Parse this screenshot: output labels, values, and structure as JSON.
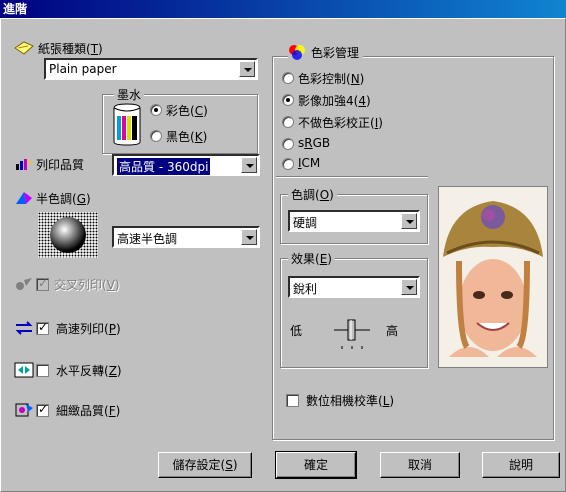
{
  "window": {
    "title": "進階"
  },
  "left": {
    "paper_type": {
      "label": "紙張種類(",
      "key": "T",
      "label_end": ")",
      "value": "Plain paper"
    },
    "ink": {
      "group_label": "墨水",
      "options": [
        {
          "label": "彩色(",
          "key": "C",
          "end": ")",
          "selected": true
        },
        {
          "label": "黑色(",
          "key": "K",
          "end": ")",
          "selected": false
        }
      ]
    },
    "print_quality": {
      "label": "列印品質",
      "value": "高品質 - 360dpi"
    },
    "halftone": {
      "label": "半色調(",
      "key": "G",
      "end": ")",
      "value": "高速半色調"
    },
    "checkboxes": [
      {
        "label": "交叉列印(",
        "key": "V",
        "end": ")",
        "checked": true,
        "disabled": true
      },
      {
        "label": "高速列印(",
        "key": "P",
        "end": ")",
        "checked": true,
        "disabled": false
      },
      {
        "label": "水平反轉(",
        "key": "Z",
        "end": ")",
        "checked": false,
        "disabled": false
      },
      {
        "label": "細緻品質(",
        "key": "F",
        "end": ")",
        "checked": true,
        "disabled": false
      }
    ]
  },
  "color_management": {
    "title": "色彩管理",
    "options": [
      {
        "label": "色彩控制(",
        "key": "N",
        "end": ")",
        "selected": false
      },
      {
        "label": "影像加強4(",
        "key": "4",
        "end": ")",
        "selected": true
      },
      {
        "label": "不做色彩校正(",
        "key": "I",
        "end": ")",
        "selected": false
      },
      {
        "label": "s",
        "key": "R",
        "end": "GB",
        "selected": false
      },
      {
        "label": "",
        "key": "I",
        "end": "CM",
        "selected": false
      }
    ],
    "tone": {
      "label": "色調(",
      "key": "O",
      "end": ")",
      "value": "硬調"
    },
    "effect": {
      "label": "效果(",
      "key": "E",
      "end": ")",
      "value": "銳利"
    },
    "slider": {
      "low": "低",
      "high": "高"
    },
    "digital_camera": {
      "label": "數位相機校準(",
      "key": "L",
      "end": ")",
      "checked": false
    }
  },
  "buttons": {
    "save": {
      "label": "儲存設定(",
      "key": "S",
      "end": ")"
    },
    "ok": "確定",
    "cancel": "取消",
    "help": "說明"
  }
}
